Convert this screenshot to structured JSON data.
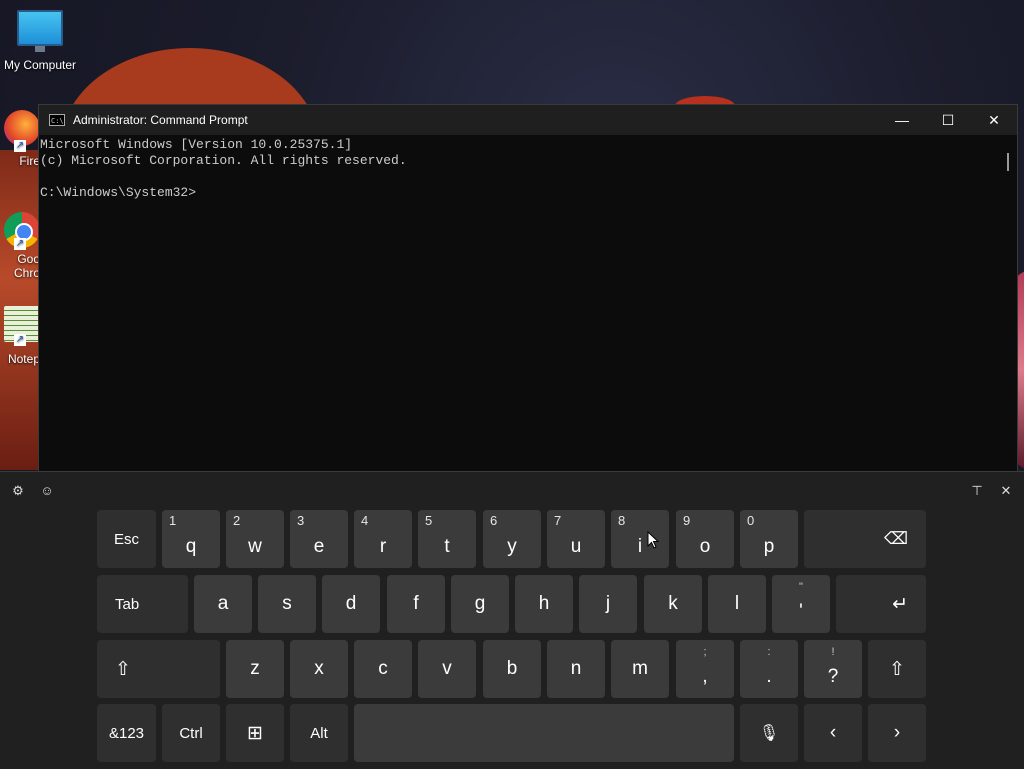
{
  "desktop": {
    "icons": [
      {
        "label": "My Computer"
      }
    ],
    "partial_labels": [
      "Fire",
      "Goo",
      "Chro",
      "Notep"
    ]
  },
  "cmd": {
    "title": "Administrator: Command Prompt",
    "lines": [
      "Microsoft Windows [Version 10.0.25375.1]",
      "(c) Microsoft Corporation. All rights reserved.",
      "",
      "C:\\Windows\\System32>"
    ],
    "controls": {
      "minimize": "—",
      "maximize": "☐",
      "close": "✕"
    }
  },
  "keyboard": {
    "toolbar": {
      "settings": "⚙",
      "emoji": "☺",
      "dock": "⊤",
      "close": "✕"
    },
    "row1": [
      {
        "label": "Esc"
      },
      {
        "label": "q",
        "hint": "1"
      },
      {
        "label": "w",
        "hint": "2"
      },
      {
        "label": "e",
        "hint": "3"
      },
      {
        "label": "r",
        "hint": "4"
      },
      {
        "label": "t",
        "hint": "5"
      },
      {
        "label": "y",
        "hint": "6"
      },
      {
        "label": "u",
        "hint": "7"
      },
      {
        "label": "i",
        "hint": "8"
      },
      {
        "label": "o",
        "hint": "9"
      },
      {
        "label": "p",
        "hint": "0"
      },
      {
        "label": "⌫"
      }
    ],
    "row2": [
      {
        "label": "Tab"
      },
      {
        "label": "a"
      },
      {
        "label": "s"
      },
      {
        "label": "d"
      },
      {
        "label": "f"
      },
      {
        "label": "g"
      },
      {
        "label": "h"
      },
      {
        "label": "j"
      },
      {
        "label": "k"
      },
      {
        "label": "l"
      },
      {
        "label": "'",
        "hint": "\""
      },
      {
        "label": "↵"
      }
    ],
    "row3": [
      {
        "label": "⇧"
      },
      {
        "label": "z"
      },
      {
        "label": "x"
      },
      {
        "label": "c"
      },
      {
        "label": "v"
      },
      {
        "label": "b"
      },
      {
        "label": "n"
      },
      {
        "label": "m"
      },
      {
        "label": ",",
        "hint": ";"
      },
      {
        "label": ".",
        "hint": ":"
      },
      {
        "label": "?",
        "hint": "!"
      },
      {
        "label": "⇧"
      }
    ],
    "row4": [
      {
        "label": "&123"
      },
      {
        "label": "Ctrl"
      },
      {
        "label": "⊞"
      },
      {
        "label": "Alt"
      },
      {
        "label": ""
      },
      {
        "label": "🎙"
      },
      {
        "label": "‹"
      },
      {
        "label": "›"
      }
    ]
  }
}
